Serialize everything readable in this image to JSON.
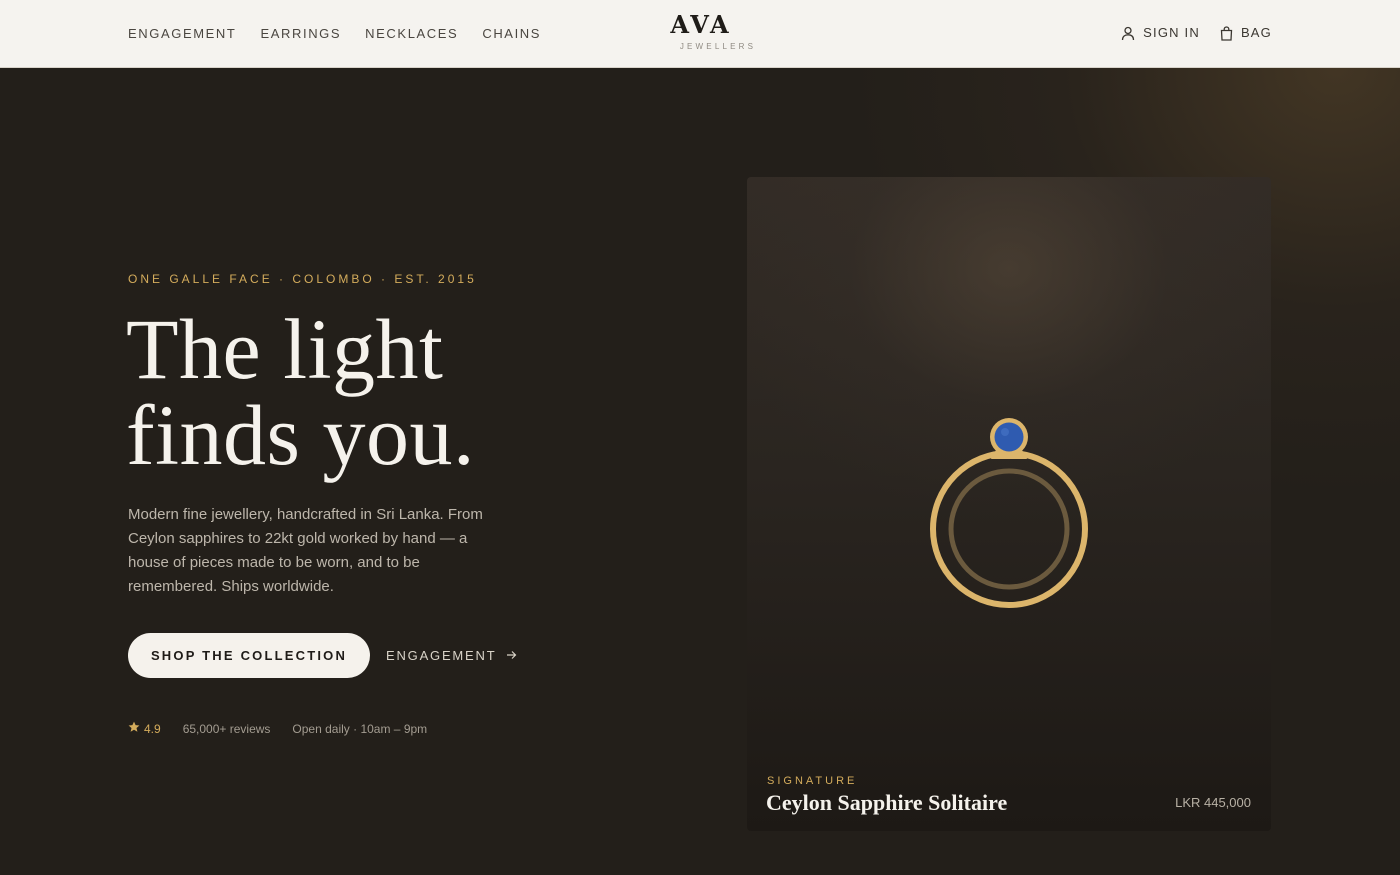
{
  "header": {
    "nav_left": [
      {
        "label": "ENGAGEMENT"
      },
      {
        "label": "EARRINGS"
      },
      {
        "label": "NECKLACES"
      },
      {
        "label": "CHAINS"
      }
    ],
    "brand_name": "AVA",
    "brand_sub": "JEWELLERS",
    "sign_in_label": "SIGN IN",
    "bag_label": "BAG",
    "icons": {
      "sign_in": "user-icon",
      "bag": "shopping-bag-icon"
    }
  },
  "hero": {
    "eyebrow": "ONE GALLE FACE · COLOMBO · EST. 2015",
    "headline_line1": "The light",
    "headline_line2": "finds you.",
    "lede": "Modern fine jewellery, handcrafted in Sri Lanka. From Ceylon sapphires to 22kt gold worked by hand — a house of pieces made to be worn, and to be remembered. Ships worldwide.",
    "cta_primary": "SHOP THE COLLECTION",
    "cta_secondary": "ENGAGEMENT",
    "rating_value": "4.9",
    "reviews": "65,000+ reviews",
    "hours": "Open daily · 10am – 9pm"
  },
  "featured": {
    "label": "SIGNATURE",
    "title": "Ceylon Sapphire Solitaire",
    "price": "LKR 445,000",
    "icon": "sapphire-ring-illustration"
  },
  "colors": {
    "background": "#231f1a",
    "header_bg": "#f5f3ef",
    "accent_gold": "#d4ac5c",
    "sapphire": "#2f5bb0",
    "cta_bg": "#f5f2ec"
  }
}
